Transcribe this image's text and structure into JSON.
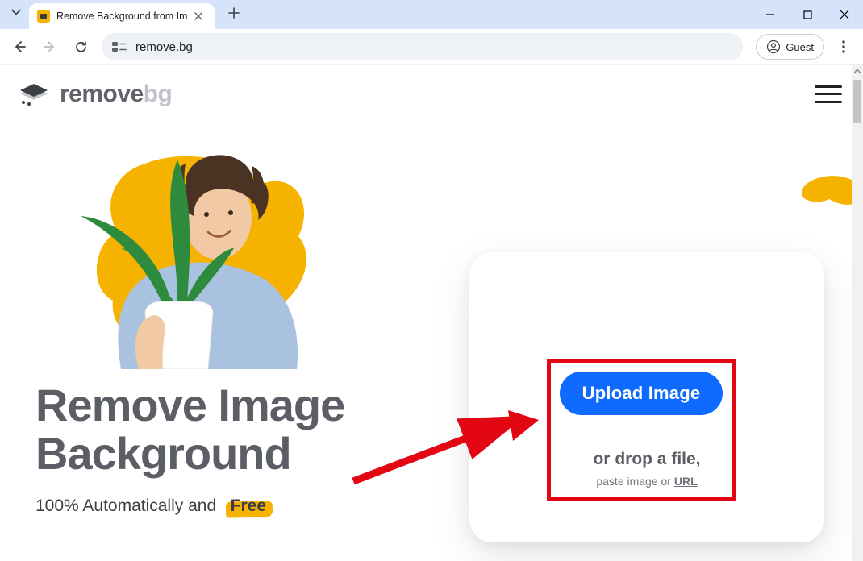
{
  "browser": {
    "tab_title": "Remove Background from Im",
    "url": "remove.bg",
    "guest_label": "Guest"
  },
  "site": {
    "logo_remove": "remove",
    "logo_bg": "bg"
  },
  "hero": {
    "headline_line1": "Remove Image",
    "headline_line2": "Background",
    "subline_prefix": "100% Automatically and",
    "subline_free": "Free"
  },
  "upload_card": {
    "button_label": "Upload Image",
    "drop_text": "or drop a file,",
    "paste_prefix": "paste image or ",
    "paste_link": "URL"
  },
  "annotation": {
    "highlight_color": "#e30613",
    "arrow_color": "#e30613"
  }
}
